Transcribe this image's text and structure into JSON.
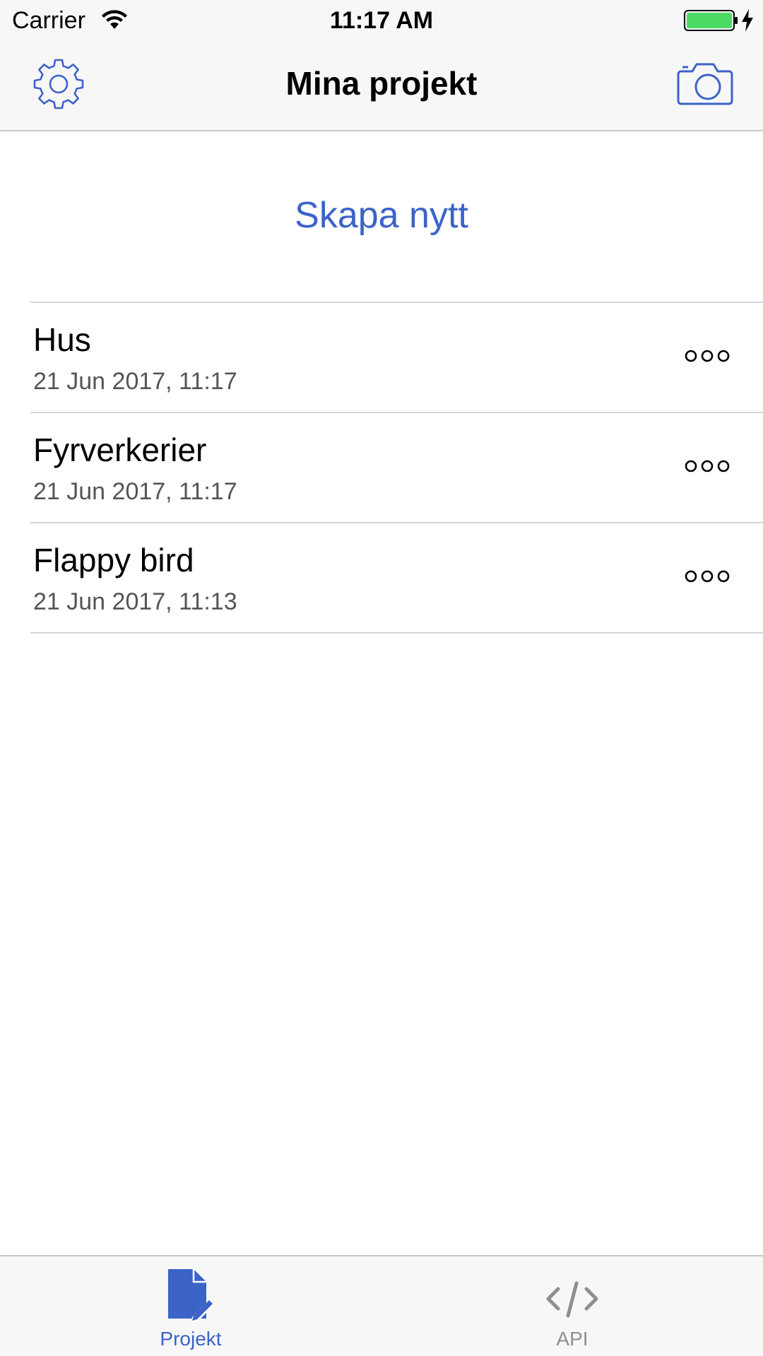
{
  "status_bar": {
    "carrier": "Carrier",
    "time": "11:17 AM",
    "battery_color": "#4cd964"
  },
  "nav_bar": {
    "title": "Mina projekt",
    "left_icon": "gear-icon",
    "right_icon": "camera-icon"
  },
  "main": {
    "create_new_label": "Skapa nytt",
    "projects": [
      {
        "name": "Hus",
        "date": "21 Jun 2017, 11:17"
      },
      {
        "name": "Fyrverkerier",
        "date": "21 Jun 2017, 11:17"
      },
      {
        "name": "Flappy bird",
        "date": "21 Jun 2017, 11:13"
      }
    ],
    "row_menu_icon": "more-icon"
  },
  "tab_bar": {
    "tabs": [
      {
        "label": "Projekt",
        "icon": "document-edit-icon",
        "selected": true
      },
      {
        "label": "API",
        "icon": "code-icon",
        "selected": false
      }
    ]
  },
  "colors": {
    "accent": "#3b63c8",
    "inactive": "#8e8e93",
    "bar_background": "#f7f7f7",
    "separator": "#d4d4d8"
  }
}
